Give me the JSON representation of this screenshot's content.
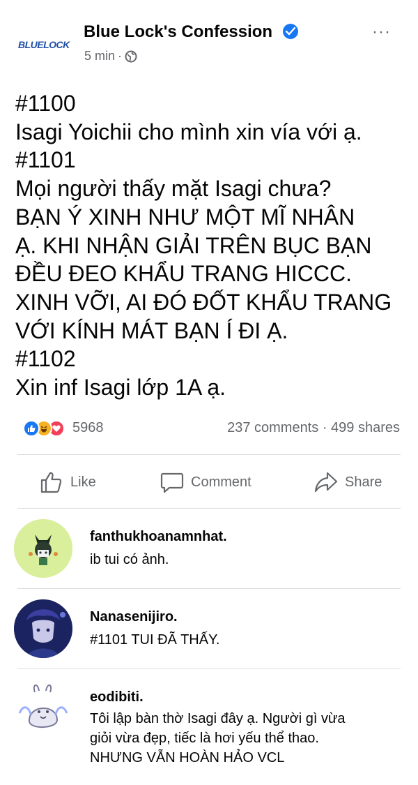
{
  "post": {
    "logo_text": "BLUELOCK",
    "page_name": "Blue Lock's Confession",
    "time": "5 min",
    "separator": "·",
    "more_label": "···",
    "body_lines": [
      "#1100",
      "Isagi Yoichii cho mình xin vía với ạ.",
      "#1101",
      "Mọi người thấy mặt Isagi chưa?",
      "BẠN Ý XINH NHƯ MỘT MĨ NHÂN",
      "Ạ. KHI NHẬN GIẢI TRÊN BỤC BẠN",
      "ĐỀU ĐEO KHẨU TRANG HICCC.",
      "XINH VỠI, AI ĐÓ ĐỐT KHẨU TRANG",
      "VỚI KÍNH MÁT BẠN Í ĐI Ạ.",
      "#1102",
      "Xin inf Isagi lớp 1A ạ."
    ]
  },
  "stats": {
    "reaction_count": "5968",
    "comments_shares": "237 comments · 499 shares"
  },
  "actions": {
    "like": "Like",
    "comment": "Comment",
    "share": "Share"
  },
  "comments": [
    {
      "name": "fanthukhoanamnhat.",
      "lines": [
        "ib tui có ảnh."
      ]
    },
    {
      "name": "Nanasenijiro.",
      "lines": [
        "#1101 TUI ĐÃ THẤY."
      ]
    },
    {
      "name": "eodibiti.",
      "lines": [
        "Tôi lập bàn thờ Isagi đây ạ. Người gì vừa",
        "giỏi vừa đẹp, tiếc là hơi yếu thể thao.",
        "NHƯNG VẪN HOÀN HẢO VCL"
      ]
    }
  ],
  "icons": {
    "verified": "verified-badge-icon",
    "privacy": "globe-icon",
    "like": "thumbs-up-icon",
    "comment": "speech-bubble-icon",
    "share": "share-arrow-icon"
  },
  "colors": {
    "accent": "#1877f2",
    "muted_text": "#65676b",
    "text": "#050505",
    "divider": "#dadde1"
  }
}
